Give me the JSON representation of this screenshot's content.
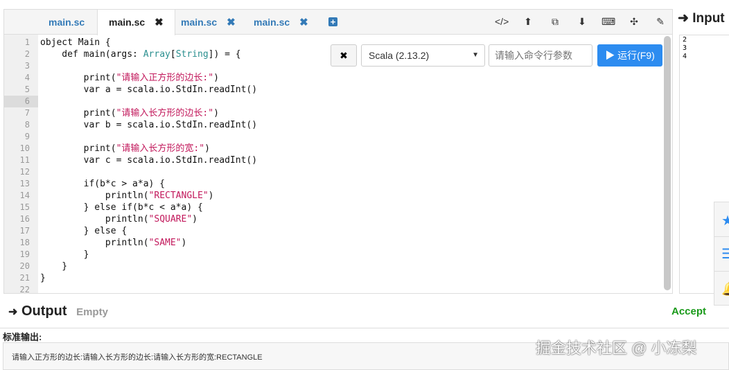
{
  "tabs": [
    {
      "label": "main.sc",
      "active": false,
      "closable": false
    },
    {
      "label": "main.sc",
      "active": true,
      "closable": true
    },
    {
      "label": "main.sc",
      "active": false,
      "closable": true
    },
    {
      "label": "main.sc",
      "active": false,
      "closable": true
    }
  ],
  "tab_close_glyph": "✖",
  "add_tab_glyph": "+",
  "toolbar": [
    {
      "name": "code-icon",
      "glyph": "</>"
    },
    {
      "name": "upload-icon",
      "glyph": "⬆"
    },
    {
      "name": "copy-icon",
      "glyph": "⧉"
    },
    {
      "name": "download-icon",
      "glyph": "⬇"
    },
    {
      "name": "keyboard-icon",
      "glyph": "⌨"
    },
    {
      "name": "fullscreen-icon",
      "glyph": "✣"
    },
    {
      "name": "edit-icon",
      "glyph": "✎"
    }
  ],
  "run": {
    "clear_glyph": "✖",
    "language": "Scala (2.13.2)",
    "args_placeholder": "请输入命令行参数",
    "run_label": "▶ 运行(F9)"
  },
  "code": [
    [
      [
        "object Main {",
        ""
      ]
    ],
    [
      [
        "    def main(args: ",
        ""
      ],
      [
        "Array",
        "type"
      ],
      [
        "[",
        ""
      ],
      [
        "String",
        "type"
      ],
      [
        "]) = {",
        ""
      ]
    ],
    [
      [
        "",
        ""
      ]
    ],
    [
      [
        "        print(",
        ""
      ],
      [
        "\"请输入正方形的边长:\"",
        "str"
      ],
      [
        ")",
        ""
      ]
    ],
    [
      [
        "        var a = scala.io.StdIn.readInt()",
        ""
      ]
    ],
    [
      [
        "        ",
        ""
      ]
    ],
    [
      [
        "        print(",
        ""
      ],
      [
        "\"请输入长方形的边长:\"",
        "str"
      ],
      [
        ")",
        ""
      ]
    ],
    [
      [
        "        var b = scala.io.StdIn.readInt()",
        ""
      ]
    ],
    [
      [
        "",
        ""
      ]
    ],
    [
      [
        "        print(",
        ""
      ],
      [
        "\"请输入长方形的宽:\"",
        "str"
      ],
      [
        ")",
        ""
      ]
    ],
    [
      [
        "        var c = scala.io.StdIn.readInt()",
        ""
      ]
    ],
    [
      [
        "",
        ""
      ]
    ],
    [
      [
        "        if(b*c > a*a) {",
        ""
      ]
    ],
    [
      [
        "            println(",
        ""
      ],
      [
        "\"RECTANGLE\"",
        "str"
      ],
      [
        ")",
        ""
      ]
    ],
    [
      [
        "        } else if(b*c < a*a) {",
        ""
      ]
    ],
    [
      [
        "            println(",
        ""
      ],
      [
        "\"SQUARE\"",
        "str"
      ],
      [
        ")",
        ""
      ]
    ],
    [
      [
        "        } else {",
        ""
      ]
    ],
    [
      [
        "            println(",
        ""
      ],
      [
        "\"SAME\"",
        "str"
      ],
      [
        ")",
        ""
      ]
    ],
    [
      [
        "        }",
        ""
      ]
    ],
    [
      [
        "    }",
        ""
      ]
    ],
    [
      [
        "}",
        ""
      ]
    ],
    [
      [
        "",
        ""
      ]
    ]
  ],
  "active_line": 6,
  "input": {
    "title": "Input",
    "lines": "2\n3\n4"
  },
  "output": {
    "title": "Output",
    "status": "Empty",
    "verdict": "Accept",
    "stdout_label": "标准输出:",
    "stdout": "请输入正方形的边长:请输入长方形的边长:请输入长方形的宽:RECTANGLE"
  },
  "watermark": "掘金技术社区 @ 小冻梨",
  "colors": {
    "accent": "#2d8cf0",
    "verdict": "#1a9a1a"
  }
}
